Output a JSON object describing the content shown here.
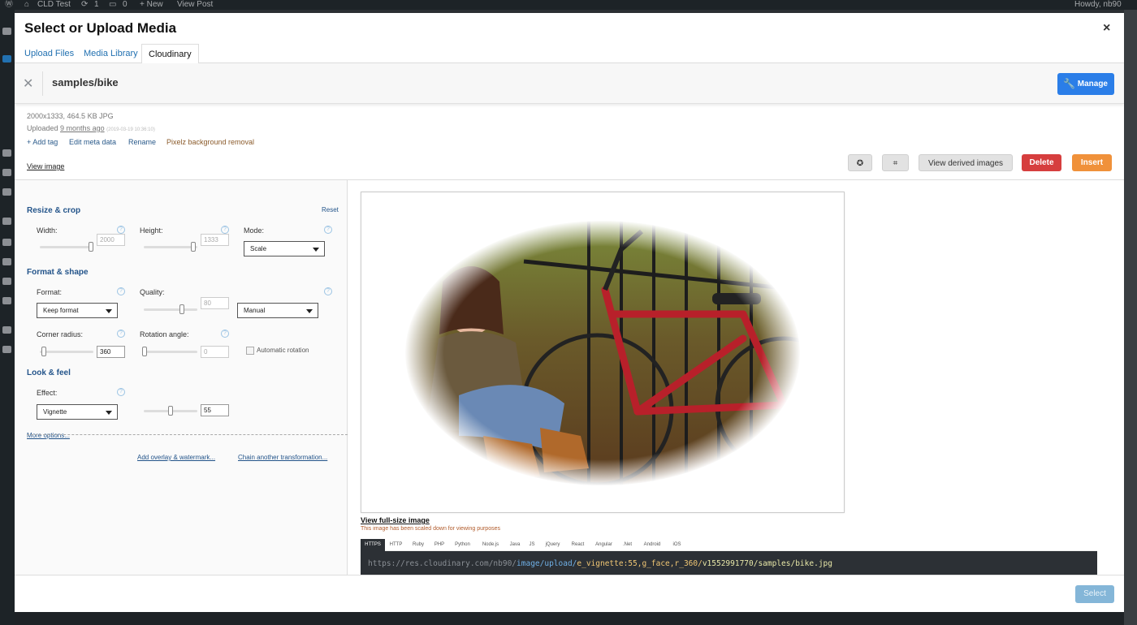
{
  "admin_bar": {
    "site_name": "CLD Test",
    "updates_count": "1",
    "comments_count": "0",
    "new_label": "+ New",
    "view_post": "View Post",
    "howdy": "Howdy, nb90"
  },
  "modal": {
    "title": "Select or Upload Media",
    "close_glyph": "×",
    "tabs": [
      "Upload Files",
      "Media Library",
      "Cloudinary"
    ],
    "active_tab": "Cloudinary"
  },
  "asset": {
    "close_glyph": "✕",
    "path": "samples/bike",
    "manage_label": "Manage",
    "dimensions_info": "2000x1333, 464.5 KB JPG",
    "uploaded_prefix": "Uploaded",
    "uploaded_ago": "9 months ago",
    "uploaded_date": "(2019-03-19 10:36:10)",
    "links": [
      "+ Add tag",
      "Edit meta data",
      "Rename",
      "Pixelz background removal"
    ],
    "view_image": "View image"
  },
  "toolbar": {
    "view_derived": "View derived images",
    "delete": "Delete",
    "insert": "Insert",
    "colors": {
      "delete": "#d63e3e",
      "insert": "#f0913a",
      "manage": "#2b7ee8"
    }
  },
  "panel": {
    "resize_crop": {
      "title": "Resize & crop",
      "reset": "Reset",
      "width_label": "Width:",
      "width_value": "2000",
      "height_label": "Height:",
      "height_value": "1333",
      "mode_label": "Mode:",
      "mode_value": "Scale"
    },
    "format_shape": {
      "title": "Format & shape",
      "format_label": "Format:",
      "format_value": "Keep format",
      "quality_label": "Quality:",
      "quality_value": "80",
      "quality_mode": "Manual",
      "corner_label": "Corner radius:",
      "corner_value": "360",
      "rotation_label": "Rotation angle:",
      "rotation_value": "0",
      "auto_rotation": "Automatic rotation"
    },
    "look_feel": {
      "title": "Look & feel",
      "effect_label": "Effect:",
      "effect_value": "Vignette",
      "effect_strength": "55"
    },
    "more_options": "More options...",
    "add_overlay": "Add overlay & watermark...",
    "chain_transform": "Chain another transformation..."
  },
  "preview": {
    "view_full_size": "View full-size image",
    "scaled_note": "This image has been scaled down for viewing purposes"
  },
  "languages": [
    "HTTPS",
    "HTTP",
    "Ruby",
    "PHP",
    "Python",
    "Node.js",
    "Java",
    "JS",
    "jQuery",
    "React",
    "Angular",
    ".Net",
    "Android",
    "iOS"
  ],
  "url": {
    "host": "https://res.cloudinary.com/nb90/",
    "type": "image/upload/",
    "transform": "e_vignette:55,g_face,r_360/",
    "version_path": "v1552991770/samples/bike.jpg"
  },
  "footer": {
    "select_label": "Select"
  }
}
